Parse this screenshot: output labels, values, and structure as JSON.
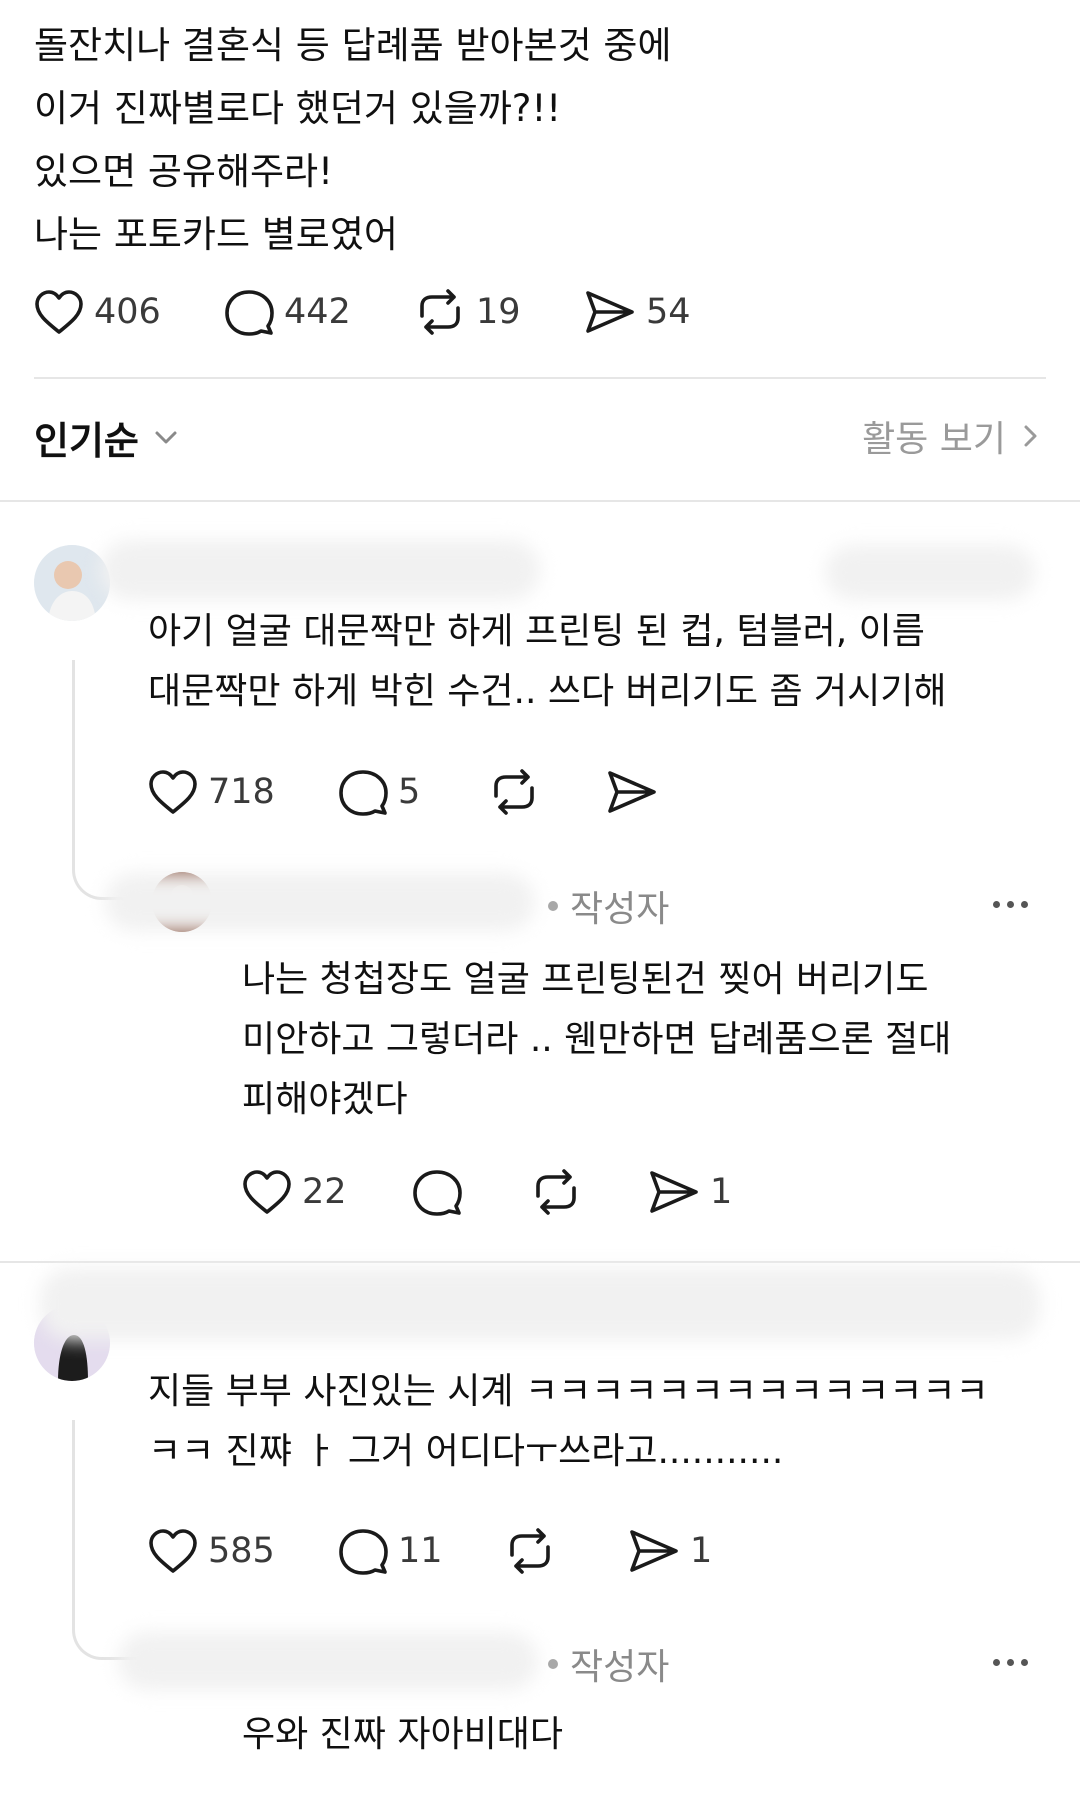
{
  "post": {
    "lines": [
      "돌잔치나 결혼식 등 답례품 받아본것 중에",
      "이거 진짜별로다 했던거 있을까?!!",
      "있으면 공유해주라!",
      "나는 포토카드 별로였어"
    ],
    "likes": "406",
    "replies": "442",
    "reposts": "19",
    "shares": "54"
  },
  "sort": {
    "label": "인기순",
    "activity_label": "활동 보기"
  },
  "comments": [
    {
      "lines": [
        "아기 얼굴 대문짝만 하게 프린팅 된 컵, 텀블러, 이름",
        "대문짝만 하게 박힌 수건.. 쓰다 버리기도 좀 거시기해"
      ],
      "likes": "718",
      "replies": "5",
      "author_reply": {
        "badge": "작성자",
        "lines": [
          "나는 청첩장도 얼굴 프린팅된건 찢어 버리기도",
          "미안하고 그렇더라 .. 웬만하면 답례품으론 절대",
          "피해야겠다"
        ],
        "likes": "22",
        "shares": "1"
      }
    },
    {
      "lines": [
        "지들 부부 사진있는 시계 ㅋㅋㅋㅋㅋㅋㅋㅋㅋㅋㅋㅋㅋㅋ",
        "ㅋㅋ 진쨔 ㅏ 그거 어디다ㅜ쓰라고..........."
      ],
      "likes": "585",
      "replies": "11",
      "shares": "1",
      "author_reply": {
        "badge": "작성자",
        "lines": [
          "우와 진짜 자아비대다"
        ]
      }
    }
  ]
}
